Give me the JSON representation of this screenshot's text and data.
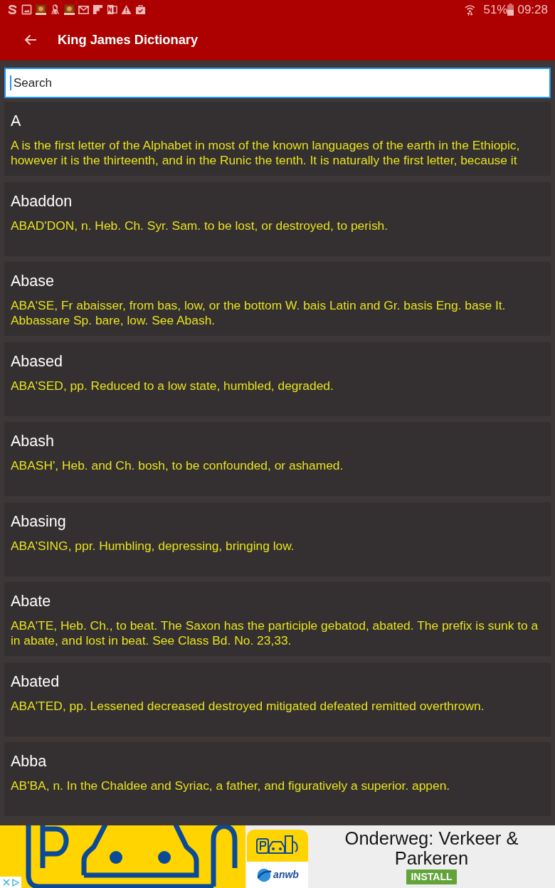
{
  "status_bar": {
    "battery": "51%",
    "time": "09:28"
  },
  "app_bar": {
    "title": "King James Dictionary"
  },
  "search": {
    "placeholder": "Search"
  },
  "entries": [
    {
      "word": "A",
      "definition": "A is the first letter of the Alphabet in most of the known languages of the earth in the Ethiopic, however it is the thirteenth, and in the Runic the tenth. It is naturally the first letter, because it"
    },
    {
      "word": "Abaddon",
      "definition": "ABAD'DON, n. Heb. Ch. Syr. Sam. to be lost, or destroyed, to perish."
    },
    {
      "word": "Abase",
      "definition": "ABA'SE, Fr abaisser, from bas, low, or the bottom W. bais Latin and Gr. basis Eng. base It. Abbassare Sp. bare, low. See Abash."
    },
    {
      "word": "Abased",
      "definition": "ABA'SED, pp. Reduced to a low state, humbled, degraded."
    },
    {
      "word": "Abash",
      "definition": "ABASH', Heb. and Ch. bosh, to be confounded, or ashamed."
    },
    {
      "word": "Abasing",
      "definition": "ABA'SING, ppr. Humbling, depressing, bringing low."
    },
    {
      "word": "Abate",
      "definition": "ABA'TE, Heb. Ch., to beat. The Saxon has the participle gebatod, abated. The prefix is sunk to a in abate, and lost in beat. See Class Bd. No. 23,33."
    },
    {
      "word": "Abated",
      "definition": "ABA'TED, pp. Lessened decreased destroyed mitigated defeated remitted overthrown."
    },
    {
      "word": "Abba",
      "definition": "AB'BA, n. In the Chaldee and Syriac, a father, and figuratively a superior. appen."
    }
  ],
  "ad": {
    "app_icon_label": "anwb",
    "title": "Onderweg: Verkeer & Parkeren",
    "button": "INSTALL"
  }
}
